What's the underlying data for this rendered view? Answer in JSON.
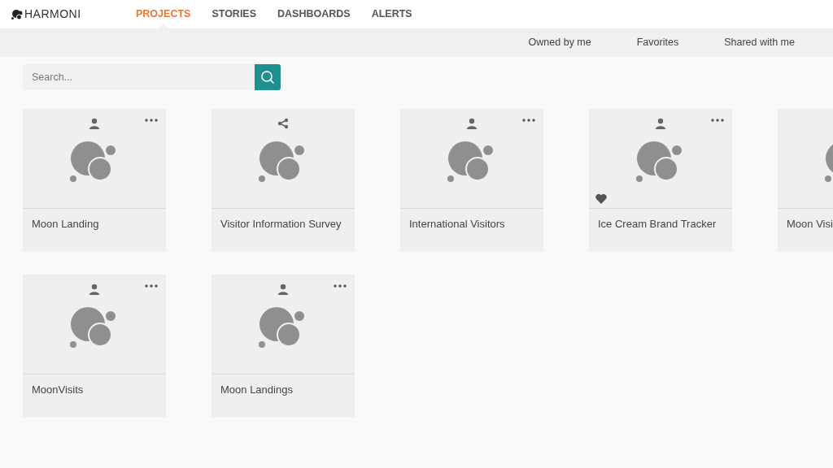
{
  "brand": "HARMONI",
  "nav": [
    {
      "label": "PROJECTS",
      "selected": true
    },
    {
      "label": "STORIES",
      "selected": false
    },
    {
      "label": "DASHBOARDS",
      "selected": false
    },
    {
      "label": "ALERTS",
      "selected": false
    }
  ],
  "filters": [
    "Owned by me",
    "Favorites",
    "Shared with me"
  ],
  "search": {
    "placeholder": "Search..."
  },
  "rows": [
    [
      {
        "title": "Moon Landing",
        "kind": "personal",
        "menu": true,
        "favorite": false
      },
      {
        "title": "Visitor Information Survey",
        "kind": "shared",
        "menu": false,
        "favorite": false
      },
      {
        "title": "International Visitors",
        "kind": "personal",
        "menu": true,
        "favorite": false
      },
      {
        "title": "Ice Cream Brand Tracker",
        "kind": "personal",
        "menu": true,
        "favorite": true
      },
      {
        "title": "Moon Visi"
      }
    ],
    [
      {
        "title": "MoonVisits",
        "kind": "personal",
        "menu": true,
        "favorite": false
      },
      {
        "title": "Moon Landings",
        "kind": "personal",
        "menu": true,
        "favorite": false
      }
    ]
  ]
}
